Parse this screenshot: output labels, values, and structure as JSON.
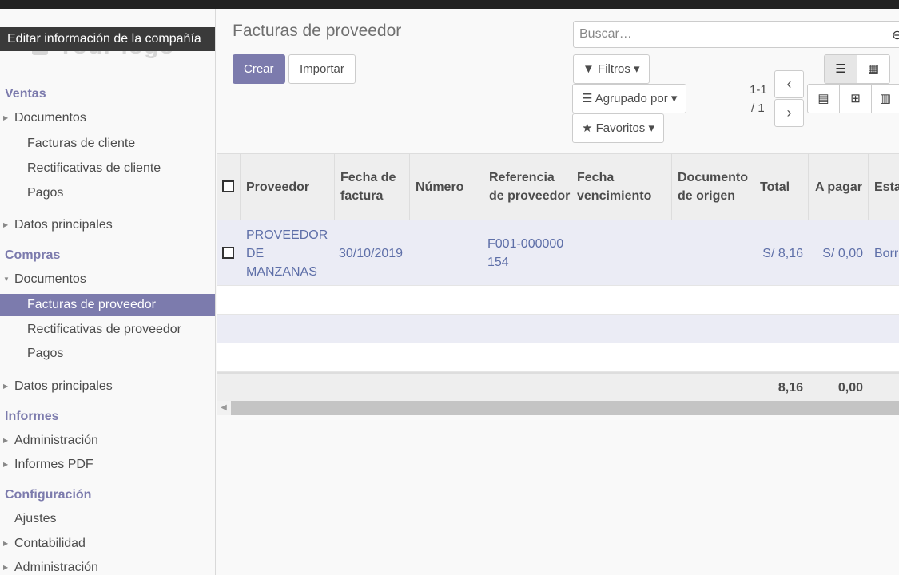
{
  "tooltip": "Editar información de la compañía",
  "logo_text": "Your logo",
  "sidebar": {
    "sections": [
      {
        "title": "Ventas"
      },
      {
        "title": "Compras"
      },
      {
        "title": "Informes"
      },
      {
        "title": "Configuración"
      }
    ],
    "items": [
      {
        "label": "Documentos"
      },
      {
        "label": "Facturas de cliente"
      },
      {
        "label": "Rectificativas de cliente"
      },
      {
        "label": "Pagos"
      },
      {
        "label": "Datos principales"
      },
      {
        "label": "Documentos"
      },
      {
        "label": "Facturas de proveedor"
      },
      {
        "label": "Rectificativas de proveedor"
      },
      {
        "label": "Pagos"
      },
      {
        "label": "Datos principales"
      },
      {
        "label": "Administración"
      },
      {
        "label": "Informes PDF"
      },
      {
        "label": "Ajustes"
      },
      {
        "label": "Contabilidad"
      },
      {
        "label": "Administración"
      }
    ]
  },
  "main": {
    "title": "Facturas de proveedor",
    "create_label": "Crear",
    "import_label": "Importar",
    "search_placeholder": "Buscar…",
    "filters_label": "Filtros",
    "groupby_label": "Agrupado por",
    "favorites_label": "Favoritos",
    "pager_range": "1-1",
    "pager_total": "/ 1"
  },
  "table": {
    "headers": [
      "Proveedor",
      "Fecha de factura",
      "Número",
      "Referencia de proveedor",
      "Fecha vencimiento",
      "Documento de origen",
      "Total",
      "A pagar",
      "Esta"
    ],
    "rows": [
      {
        "proveedor": "PROVEEDOR DE MANZANAS",
        "fecha": "30/10/2019",
        "numero": "",
        "referencia": "F001-000000154",
        "vencimiento": "",
        "origen": "",
        "total": "S/ 8,16",
        "a_pagar": "S/ 0,00",
        "estado": "Borra"
      }
    ],
    "totals": {
      "total": "8,16",
      "a_pagar": "0,00"
    }
  },
  "colors": {
    "accent": "#7c7bad",
    "link": "#5e6fa8"
  }
}
